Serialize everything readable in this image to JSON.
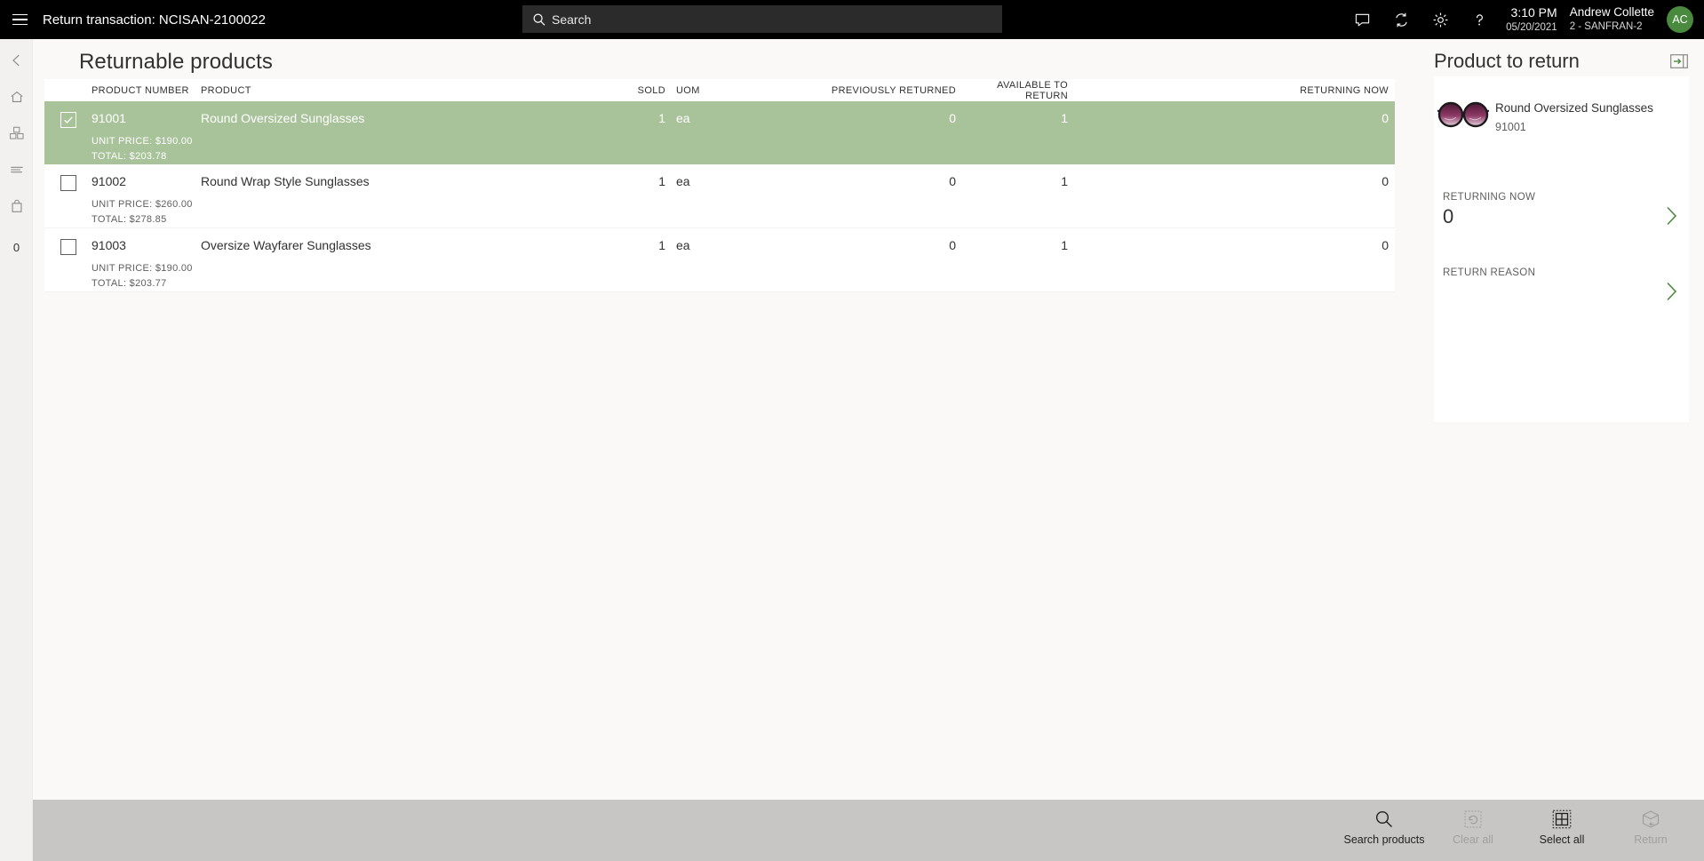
{
  "topbar": {
    "menu_icon": "hamburger-icon",
    "title": "Return transaction: NCISAN-2100022",
    "search": {
      "placeholder": "Search",
      "icon": "search-icon",
      "value": ""
    },
    "icons": [
      "feedback-icon",
      "sync-icon",
      "gear-icon",
      "help-icon"
    ],
    "time": "3:10 PM",
    "date": "05/20/2021",
    "user_name": "Andrew Collette",
    "store": "2 - SANFRAN-2",
    "avatar_initials": "AC",
    "avatar_color": "#4a8a3f"
  },
  "rail": {
    "items": [
      {
        "name": "back-icon",
        "label": "Back"
      },
      {
        "name": "home-icon",
        "label": "Home"
      },
      {
        "name": "products-icon",
        "label": "Products"
      },
      {
        "name": "journal-icon",
        "label": "Journal"
      },
      {
        "name": "bag-icon",
        "label": "Cart"
      }
    ],
    "count": "0"
  },
  "main": {
    "page_title": "Returnable products",
    "columns": [
      "PRODUCT NUMBER",
      "PRODUCT",
      "SOLD",
      "UOM",
      "PREVIOUSLY RETURNED",
      "AVAILABLE TO RETURN",
      "RETURNING NOW"
    ],
    "rows": [
      {
        "selected": true,
        "checked": true,
        "product_number": "91001",
        "product": "Round Oversized Sunglasses",
        "sold": "1",
        "uom": "ea",
        "previously_returned": "0",
        "available_to_return": "1",
        "returning_now": "0",
        "unit_price": "UNIT PRICE: $190.00",
        "total": "TOTAL: $203.78"
      },
      {
        "selected": false,
        "checked": false,
        "product_number": "91002",
        "product": "Round Wrap Style Sunglasses",
        "sold": "1",
        "uom": "ea",
        "previously_returned": "0",
        "available_to_return": "1",
        "returning_now": "0",
        "unit_price": "UNIT PRICE: $260.00",
        "total": "TOTAL: $278.85"
      },
      {
        "selected": false,
        "checked": false,
        "product_number": "91003",
        "product": "Oversize Wayfarer Sunglasses",
        "sold": "1",
        "uom": "ea",
        "previously_returned": "0",
        "available_to_return": "1",
        "returning_now": "0",
        "unit_price": "UNIT PRICE: $190.00",
        "total": "TOTAL: $203.77"
      }
    ]
  },
  "right_panel": {
    "title": "Product to return",
    "expand_icon": "expand-panel-icon",
    "product": {
      "image": "sunglasses-thumbnail",
      "name": "Round Oversized Sunglasses",
      "number": "91001"
    },
    "fields": [
      {
        "label": "RETURNING NOW",
        "value": "0",
        "chevron": "chevron-right-icon"
      },
      {
        "label": "RETURN REASON",
        "value": "",
        "chevron": "chevron-right-icon"
      }
    ]
  },
  "bottom_bar": {
    "buttons": [
      {
        "label": "Search products",
        "icon": "magnifier-icon",
        "disabled": false
      },
      {
        "label": "Clear all",
        "icon": "clear-icon",
        "disabled": true
      },
      {
        "label": "Select all",
        "icon": "select-all-icon",
        "disabled": false
      },
      {
        "label": "Return",
        "icon": "return-box-icon",
        "disabled": true
      }
    ]
  },
  "colors": {
    "selection_green": "#a8c39a",
    "topbar_black": "#000000",
    "bottom_gray": "#c8c6c4",
    "page_bg": "#faf9f8",
    "accent_green": "#4a8a3f"
  }
}
